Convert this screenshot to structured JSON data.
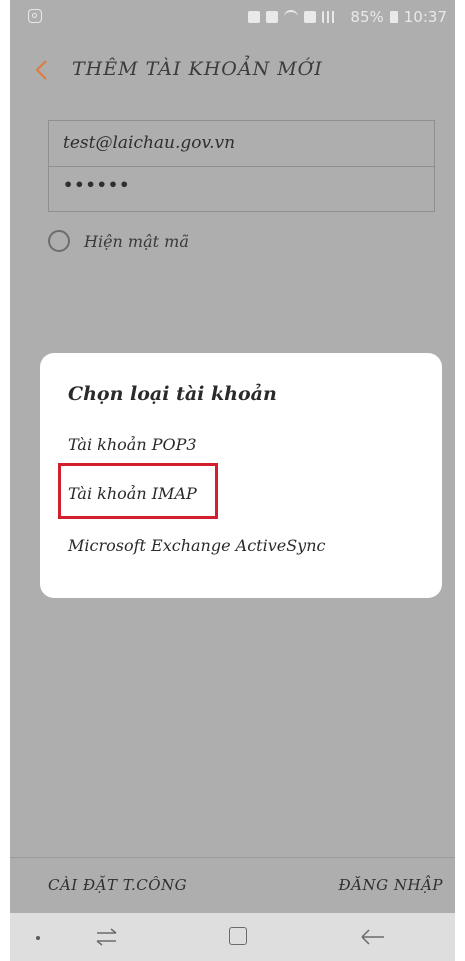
{
  "status_bar": {
    "battery": "85%",
    "time": "10:37"
  },
  "app_bar": {
    "title": "THÊM TÀI KHOẢN MỚI"
  },
  "form": {
    "email_value": "test@laichau.gov.vn",
    "password_masked": "••••••",
    "show_password_label": "Hiện mật mã"
  },
  "dialog": {
    "title": "Chọn loại tài khoản",
    "options": [
      {
        "label": "Tài khoản POP3"
      },
      {
        "label": "Tài khoản IMAP",
        "highlighted": true
      },
      {
        "label": "Microsoft Exchange ActiveSync"
      }
    ]
  },
  "bottom": {
    "manual_setup": "CÀI ĐẶT T.CÔNG",
    "login": "ĐĂNG NHẬP"
  },
  "colors": {
    "accent_back": "#e07a3c",
    "highlight": "#d21f2e"
  }
}
